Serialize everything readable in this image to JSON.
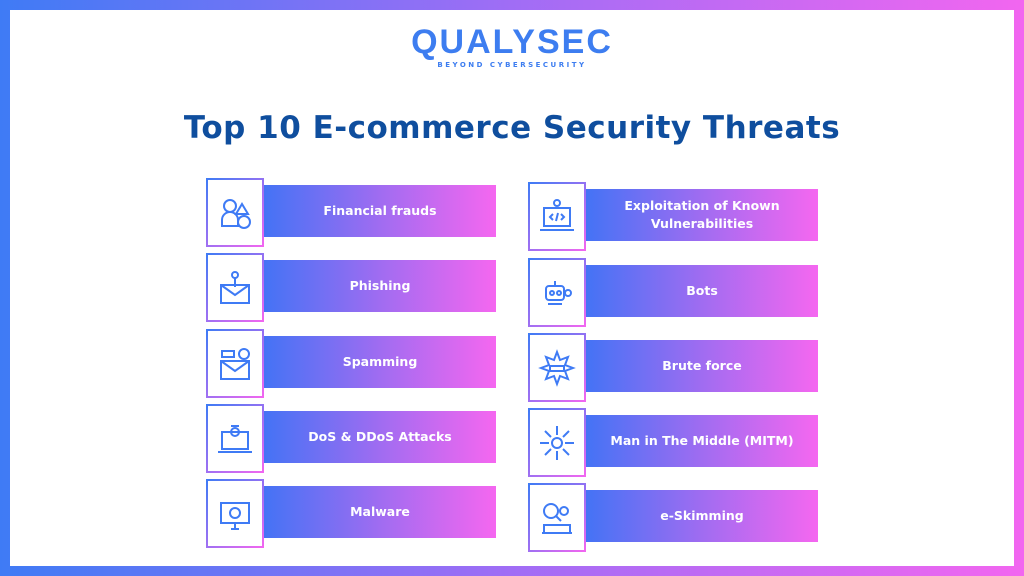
{
  "logo": {
    "name": "QUALYSEC",
    "tagline": "BEYOND CYBERSECURITY"
  },
  "title": "Top 10 E-commerce Security Threats",
  "colors": {
    "accent_blue": "#3f7bf5",
    "accent_pink": "#f266f0",
    "title": "#0f4e9e"
  },
  "left": [
    {
      "label": "Financial frauds",
      "icon": "thief-money-bag-icon"
    },
    {
      "label": "Phishing",
      "icon": "envelope-hook-icon"
    },
    {
      "label": "Spamming",
      "icon": "spam-envelope-icon"
    },
    {
      "label": "DoS & DDoS Attacks",
      "icon": "laptop-bug-icon"
    },
    {
      "label": "Malware",
      "icon": "monitor-virus-icon"
    }
  ],
  "right": [
    {
      "label": "Exploitation of Known Vulnerabilities",
      "icon": "laptop-code-icon"
    },
    {
      "label": "Bots",
      "icon": "robot-icon"
    },
    {
      "label": "Brute force",
      "icon": "burst-password-icon"
    },
    {
      "label": "Man in The Middle (MITM)",
      "icon": "network-intercept-icon"
    },
    {
      "label": "e-Skimming",
      "icon": "magnifier-person-book-icon"
    }
  ]
}
